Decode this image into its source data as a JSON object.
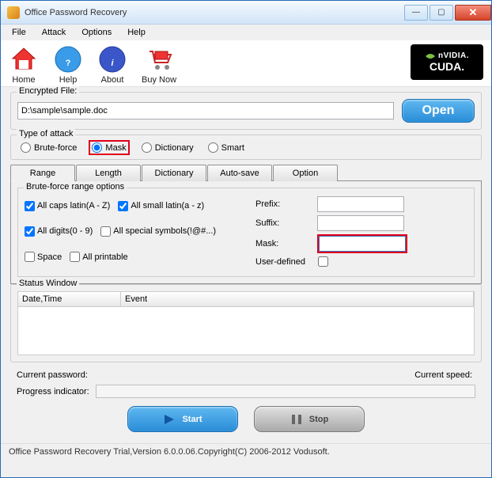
{
  "window": {
    "title": "Office Password Recovery"
  },
  "menu": {
    "file": "File",
    "attack": "Attack",
    "options": "Options",
    "help": "Help"
  },
  "toolbar": {
    "home": "Home",
    "help": "Help",
    "about": "About",
    "buy": "Buy Now",
    "cuda_brand": "nVIDIA.",
    "cuda_label": "CUDA."
  },
  "file": {
    "legend": "Encrypted File:",
    "path": "D:\\sample\\sample.doc",
    "open": "Open"
  },
  "attack": {
    "legend": "Type of attack",
    "brute": "Brute-force",
    "mask": "Mask",
    "dict": "Dictionary",
    "smart": "Smart",
    "selected": "mask"
  },
  "tabs": {
    "range": "Range",
    "length": "Length",
    "dict": "Dictionary",
    "auto": "Auto-save",
    "option": "Option"
  },
  "range": {
    "legend": "Brute-force range options",
    "caps": "All caps latin(A - Z)",
    "small": "All small latin(a - z)",
    "digits": "All digits(0 - 9)",
    "symbols": "All special symbols(!@#...)",
    "space": "Space",
    "printable": "All printable",
    "prefix": "Prefix:",
    "suffix": "Suffix:",
    "mask": "Mask:",
    "userdef": "User-defined",
    "prefix_val": "",
    "suffix_val": "",
    "mask_val": ""
  },
  "status": {
    "legend": "Status Window",
    "col1": "Date,Time",
    "col2": "Event"
  },
  "bottom": {
    "curpass": "Current password:",
    "curspeed": "Current speed:",
    "prog": "Progress indicator:",
    "curpass_val": "",
    "curspeed_val": ""
  },
  "actions": {
    "start": "Start",
    "stop": "Stop"
  },
  "footer": "Office Password Recovery Trial,Version 6.0.0.06.Copyright(C) 2006-2012 Vodusoft."
}
